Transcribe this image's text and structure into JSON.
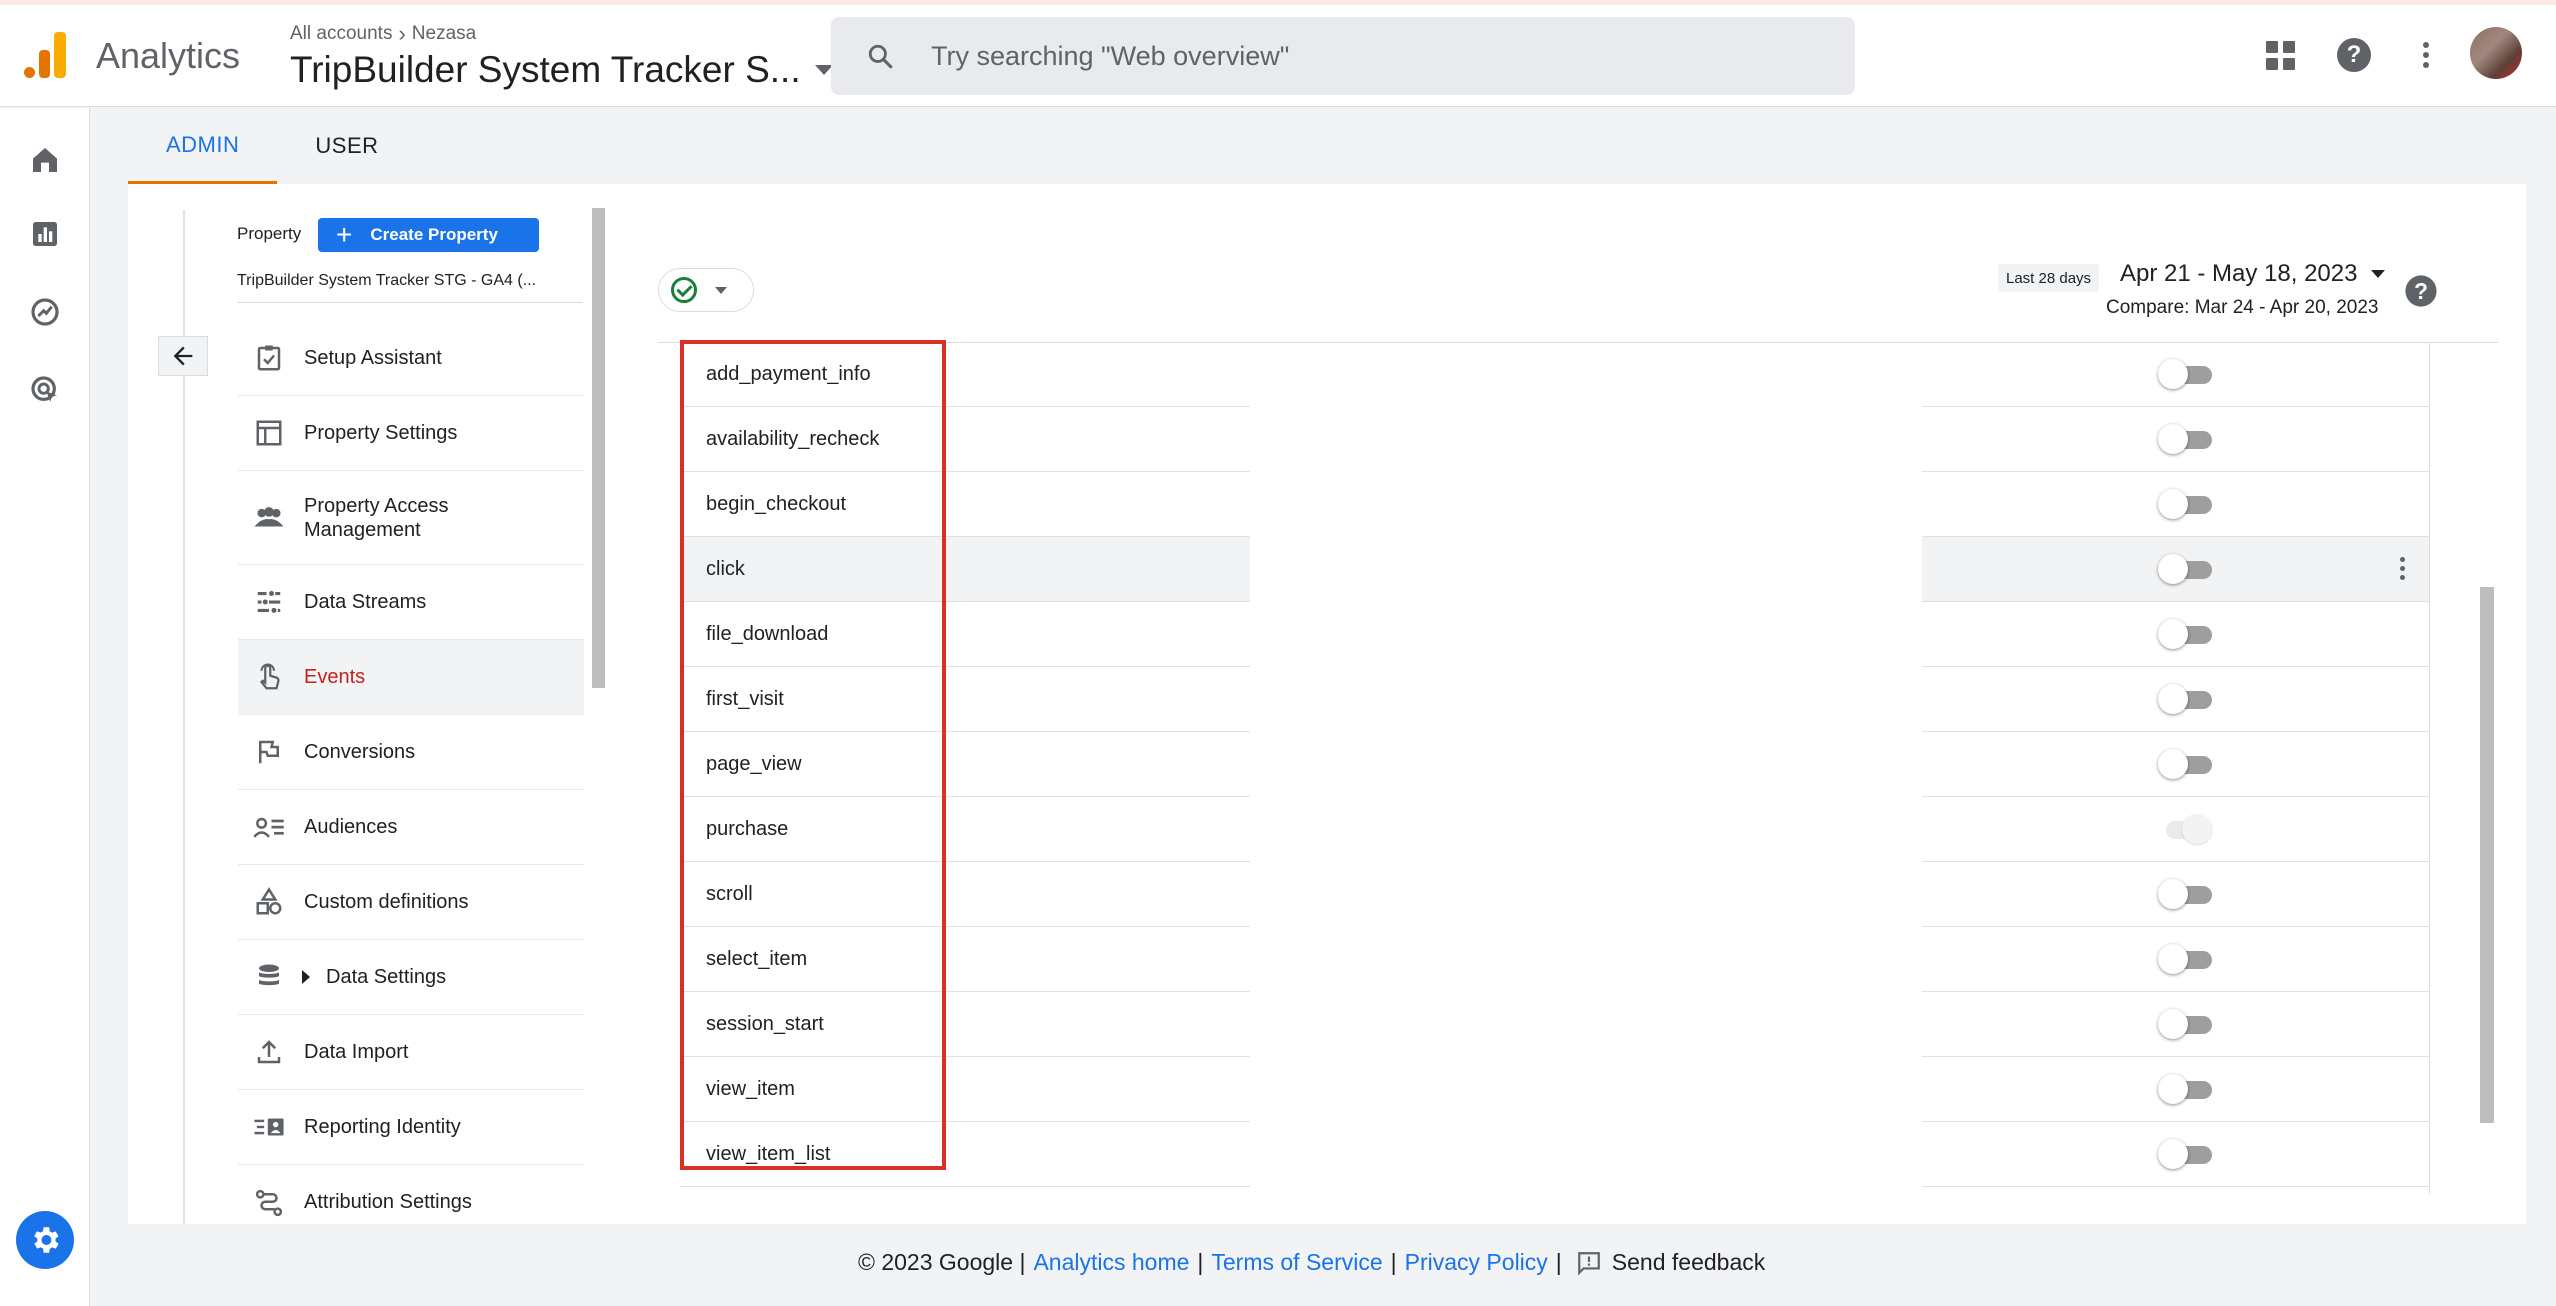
{
  "header": {
    "product_name": "Analytics",
    "breadcrumb_root": "All accounts",
    "breadcrumb_account": "Nezasa",
    "property_title": "TripBuilder System Tracker S...",
    "search_placeholder": "Try searching \"Web overview\""
  },
  "tabs": [
    {
      "label": "ADMIN",
      "active": true
    },
    {
      "label": "USER",
      "active": false
    }
  ],
  "property": {
    "label": "Property",
    "create_button": "Create Property",
    "selected": "TripBuilder System Tracker STG - GA4 (..."
  },
  "nav": {
    "items": [
      {
        "label": "Setup Assistant",
        "icon": "clipboard-check-icon"
      },
      {
        "label": "Property Settings",
        "icon": "layout-icon"
      },
      {
        "label": "Property Access Management",
        "icon": "people-icon"
      },
      {
        "label": "Data Streams",
        "icon": "streams-icon"
      },
      {
        "label": "Events",
        "icon": "touch-icon",
        "active": true
      },
      {
        "label": "Conversions",
        "icon": "flag-icon"
      },
      {
        "label": "Audiences",
        "icon": "audience-icon"
      },
      {
        "label": "Custom definitions",
        "icon": "shapes-icon"
      },
      {
        "label": "Data Settings",
        "icon": "database-icon",
        "expandable": true
      },
      {
        "label": "Data Import",
        "icon": "upload-icon"
      },
      {
        "label": "Reporting Identity",
        "icon": "identity-icon"
      },
      {
        "label": "Attribution Settings",
        "icon": "attribution-icon"
      }
    ]
  },
  "date": {
    "badge": "Last 28 days",
    "range": "Apr 21 - May 18, 2023",
    "compare": "Compare: Mar 24 - Apr 20, 2023"
  },
  "events": [
    {
      "name": "add_payment_info",
      "conversion": false
    },
    {
      "name": "availability_recheck",
      "conversion": false
    },
    {
      "name": "begin_checkout",
      "conversion": false
    },
    {
      "name": "click",
      "conversion": false,
      "hovered": true
    },
    {
      "name": "file_download",
      "conversion": false
    },
    {
      "name": "first_visit",
      "conversion": false
    },
    {
      "name": "page_view",
      "conversion": false
    },
    {
      "name": "purchase",
      "conversion": true,
      "disabled": true
    },
    {
      "name": "scroll",
      "conversion": false
    },
    {
      "name": "select_item",
      "conversion": false
    },
    {
      "name": "session_start",
      "conversion": false
    },
    {
      "name": "view_item",
      "conversion": false
    },
    {
      "name": "view_item_list",
      "conversion": false
    }
  ],
  "footer": {
    "copyright": "© 2023 Google |",
    "analytics_home": "Analytics home",
    "terms": "Terms of Service",
    "privacy": "Privacy Policy",
    "feedback": "Send feedback"
  },
  "colors": {
    "accent": "#1a73e8",
    "active_nav": "#c5221f",
    "highlight_box": "#d93025",
    "tab_underline": "#e37400"
  }
}
